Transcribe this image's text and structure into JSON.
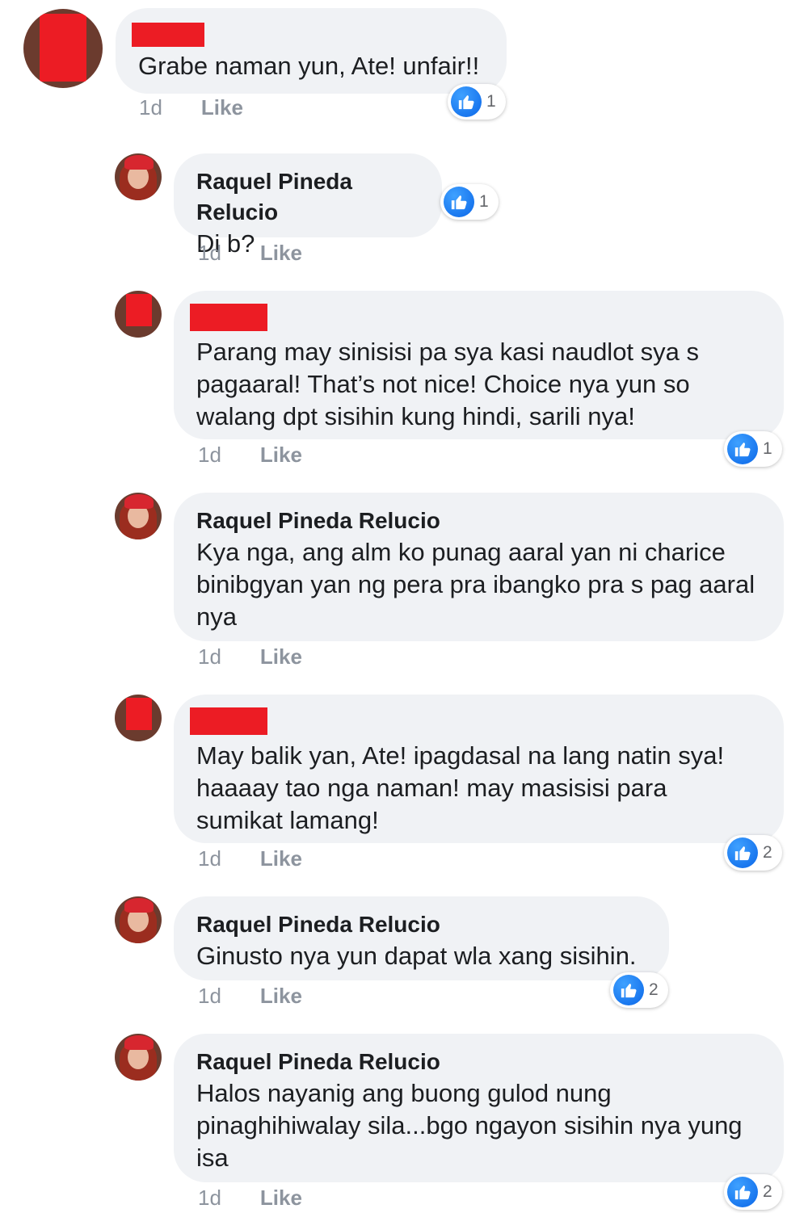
{
  "comments": [
    {
      "author": "",
      "text": "Grabe naman yun, Ate! unfair!!",
      "time": "1d",
      "like_label": "Like",
      "reactions": "1"
    },
    {
      "author": "Raquel Pineda Relucio",
      "text": "Di b?",
      "time": "1d",
      "like_label": "Like",
      "reactions": "1"
    },
    {
      "author": "",
      "text": "Parang may sinisisi pa sya kasi naudlot sya s\npagaaral! That’s not nice! Choice nya yun so\nwalang dpt sisihin kung hindi, sarili nya!",
      "time": "1d",
      "like_label": "Like",
      "reactions": "1"
    },
    {
      "author": "Raquel Pineda Relucio",
      "text": "Kya nga, ang alm ko punag aaral yan ni charice\nbinibgyan yan ng pera pra ibangko pra s pag aaral\nnya",
      "time": "1d",
      "like_label": "Like",
      "reactions": ""
    },
    {
      "author": "",
      "text": "May balik yan, Ate! ipagdasal na lang natin sya!\nhaaaay tao nga naman! may masisisi para\nsumikat lamang!",
      "time": "1d",
      "like_label": "Like",
      "reactions": "2"
    },
    {
      "author": "Raquel Pineda Relucio",
      "text": "Ginusto nya yun dapat wla xang sisihin.",
      "time": "1d",
      "like_label": "Like",
      "reactions": "2"
    },
    {
      "author": "Raquel Pineda Relucio",
      "text": "Halos nayanig ang buong gulod nung\npinaghihiwalay sila...bgo ngayon sisihin nya yung\nisa",
      "time": "1d",
      "like_label": "Like",
      "reactions": "2"
    }
  ],
  "icons": {
    "avatar": "profile-photo",
    "reaction": "thumbs-up-icon"
  },
  "colors": {
    "bubble": "#f0f2f5",
    "like_blue": "#1877f2",
    "redaction": "#ec1c24"
  }
}
